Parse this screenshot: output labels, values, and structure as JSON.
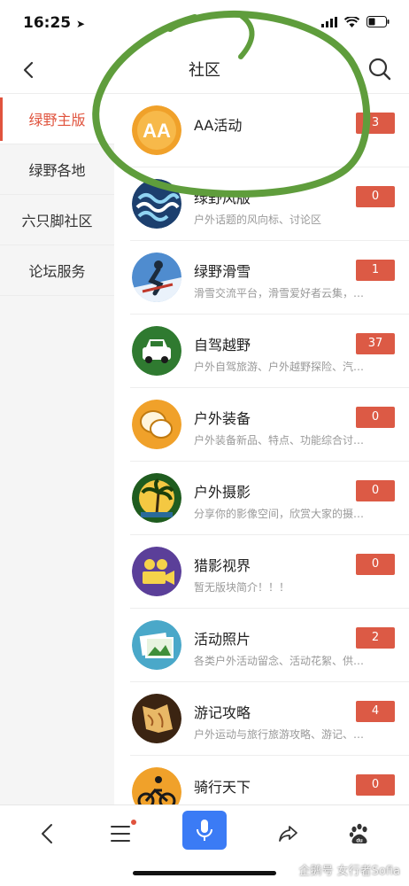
{
  "status": {
    "time": "16:25"
  },
  "nav": {
    "title": "社区"
  },
  "sidebar": {
    "items": [
      {
        "label": "绿野主版",
        "active": true
      },
      {
        "label": "绿野各地",
        "active": false
      },
      {
        "label": "六只脚社区",
        "active": false
      },
      {
        "label": "论坛服务",
        "active": false
      }
    ]
  },
  "forums": [
    {
      "title": "AA活动",
      "desc": "",
      "count": "3",
      "icon": "aa-activity-icon"
    },
    {
      "title": "绿野风版",
      "desc": "户外话题的风向标、讨论区",
      "count": "0",
      "icon": "wind-waves-icon"
    },
    {
      "title": "绿野滑雪",
      "desc": "滑雪交流平台，滑雪爱好者云集，…",
      "count": "1",
      "icon": "skier-icon"
    },
    {
      "title": "自驾越野",
      "desc": "户外自驾旅游、户外越野探险、汽…",
      "count": "37",
      "icon": "car-icon"
    },
    {
      "title": "户外装备",
      "desc": "户外装备新品、特点、功能综合讨…",
      "count": "0",
      "icon": "speech-bubbles-icon"
    },
    {
      "title": "户外摄影",
      "desc": "分享你的影像空间，欣赏大家的摄…",
      "count": "0",
      "icon": "palm-tree-icon"
    },
    {
      "title": "猎影视界",
      "desc": "暂无版块简介！！！",
      "count": "0",
      "icon": "video-camera-icon"
    },
    {
      "title": "活动照片",
      "desc": "各类户外活动留念、活动花絮、供…",
      "count": "2",
      "icon": "photos-icon"
    },
    {
      "title": "游记攻略",
      "desc": "户外运动与旅行旅游攻略、游记、…",
      "count": "4",
      "icon": "map-icon"
    },
    {
      "title": "骑行天下",
      "desc": "",
      "count": "0",
      "icon": "cyclist-icon"
    }
  ],
  "watermark": "企鹅号 女行者Sofia",
  "colors": {
    "accent": "#e0533d",
    "badge": "#dc5a45",
    "mic": "#3b7bf5",
    "annotation": "#5f9d3c"
  }
}
